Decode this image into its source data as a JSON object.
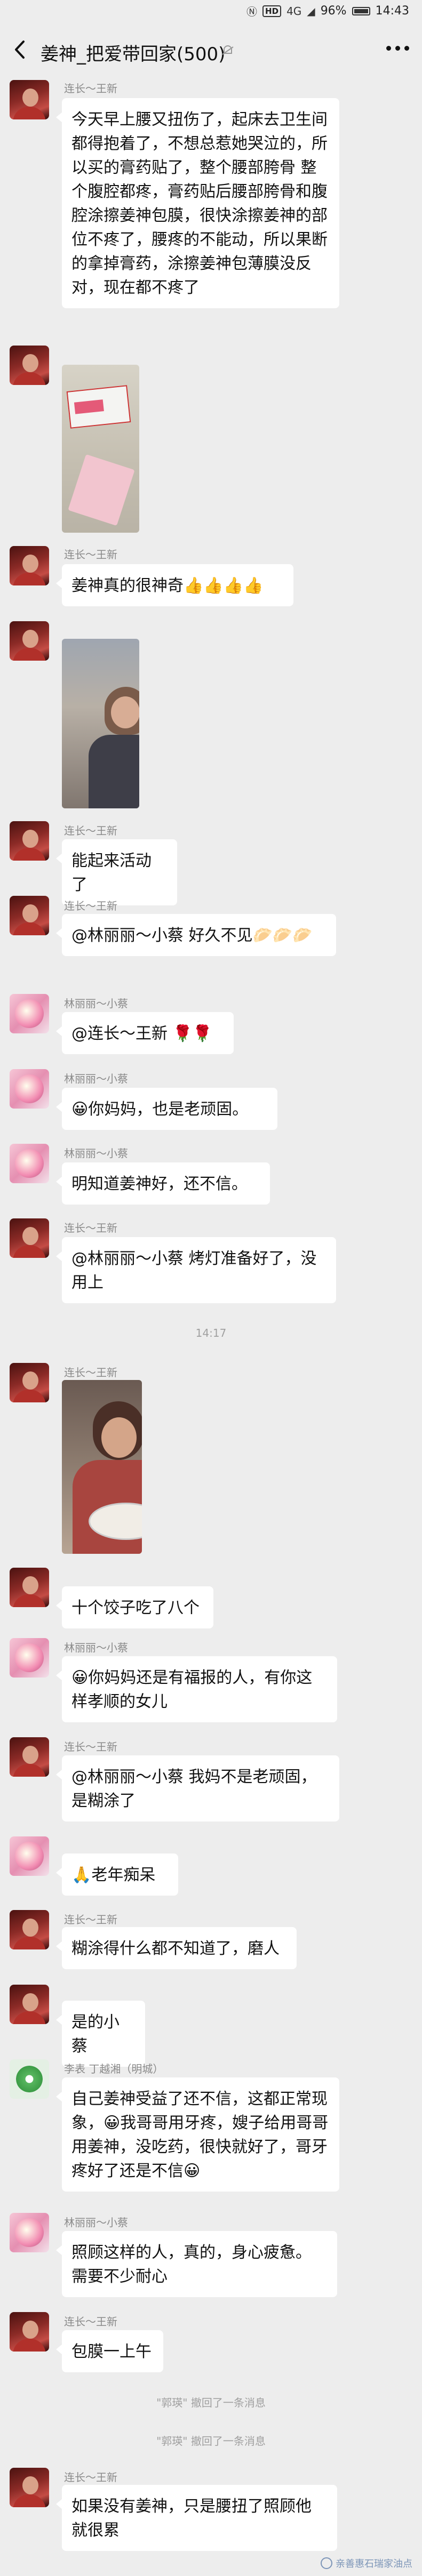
{
  "status_bar": {
    "hd": "HD",
    "network": "4G",
    "battery": "96%",
    "time": "14:43"
  },
  "header": {
    "title": "姜神_把爱带回家(500)"
  },
  "messages": [
    {
      "sender": "连长～王新",
      "text": "今天早上腰又扭伤了，起床去卫生间都得抱着了，不想总惹她哭泣的，所以买的膏药贴了，整个腰部胯骨 整个腹腔都疼，膏药贴后腰部胯骨和腹腔涂擦姜神包膜，很快涂擦姜神的部位不疼了，腰疼的不能动，所以果断的拿掉膏药，涂擦姜神包薄膜没反对，现在都不疼了"
    },
    {
      "sender": "",
      "image": "medicine-box-photo"
    },
    {
      "sender": "连长～王新",
      "text": "姜神真的很神奇👍👍👍👍"
    },
    {
      "sender": "",
      "image": "elderly-woman-photo"
    },
    {
      "sender": "连长～王新",
      "text": "能起来活动了"
    },
    {
      "sender": "连长～王新",
      "text": "@林丽丽～小蔡  好久不见🥟🥟🥟"
    },
    {
      "sender": "林丽丽～小蔡",
      "text": "@连长～王新  🌹🌹"
    },
    {
      "sender": "林丽丽～小蔡",
      "text": "😀你妈妈，也是老顽固。"
    },
    {
      "sender": "林丽丽～小蔡",
      "text": "明知道姜神好，还不信。"
    },
    {
      "sender": "连长～王新",
      "text": "@林丽丽～小蔡  烤灯准备好了，没用上"
    },
    {
      "sender": "连长～王新",
      "image": "dumplings-photo"
    },
    {
      "sender": "",
      "text": "十个饺子吃了八个"
    },
    {
      "sender": "林丽丽～小蔡",
      "text": "😀你妈妈还是有福报的人，有你这样孝顺的女儿"
    },
    {
      "sender": "连长～王新",
      "text": "@林丽丽～小蔡  我妈不是老顽固，是糊涂了"
    },
    {
      "sender": "",
      "text": "🙏老年痴呆"
    },
    {
      "sender": "连长～王新",
      "text": "糊涂得什么都不知道了，磨人"
    },
    {
      "sender": "",
      "text": "是的小蔡"
    },
    {
      "sender": "李表 丁越湘（明城）",
      "text": "自己姜神受益了还不信，这都正常现象，😀我哥哥用牙疼，嫂子给用哥哥用姜神，没吃药，很快就好了，哥牙疼好了还是不信😀"
    },
    {
      "sender": "林丽丽～小蔡",
      "text": "照顾这样的人，真的，身心疲惫。需要不少耐心"
    },
    {
      "sender": "连长～王新",
      "text": "包膜一上午"
    },
    {
      "sender": "连长～王新",
      "text": "如果没有姜神，只是腰扭了照顾他就很累"
    }
  ],
  "time_divider": "14:17",
  "system": [
    "\"郭瑛\" 撤回了一条消息",
    "\"郭瑛\" 撤回了一条消息"
  ],
  "watermark": "亲善惠石瑞家油点"
}
